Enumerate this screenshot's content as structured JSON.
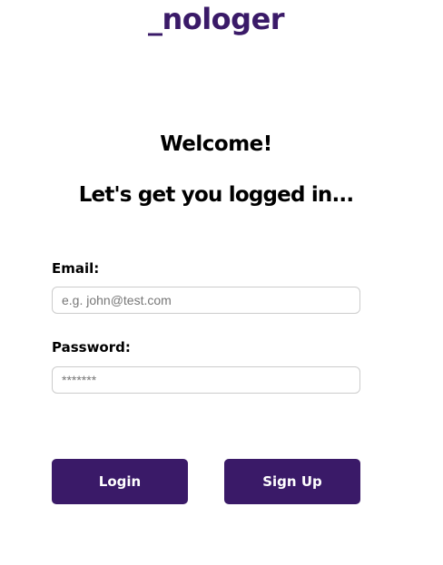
{
  "brand": {
    "logo_text": "_nologer",
    "accent_color": "#3a1a68"
  },
  "header": {
    "welcome": "Welcome!",
    "subtitle": "Let's get you logged in..."
  },
  "form": {
    "email_label": "Email:",
    "email_placeholder": "e.g. john@test.com",
    "email_value": "",
    "password_label": "Password:",
    "password_placeholder": "*******",
    "password_value": ""
  },
  "actions": {
    "login_label": "Login",
    "signup_label": "Sign Up"
  }
}
